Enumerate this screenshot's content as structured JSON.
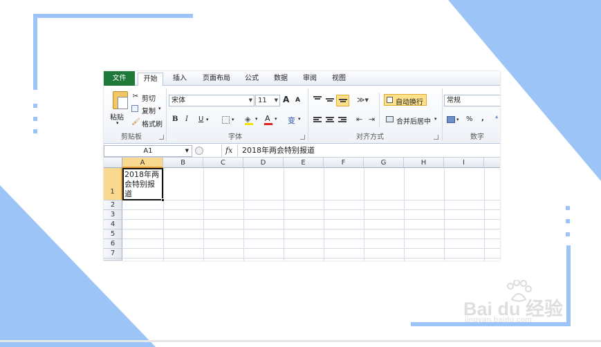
{
  "tabs": [
    {
      "label": "文件"
    },
    {
      "label": "开始"
    },
    {
      "label": "插入"
    },
    {
      "label": "页面布局"
    },
    {
      "label": "公式"
    },
    {
      "label": "数据"
    },
    {
      "label": "审阅"
    },
    {
      "label": "视图"
    }
  ],
  "clipboard": {
    "paste": "粘贴",
    "cut": "剪切",
    "copy": "复制",
    "format_painter": "格式刷",
    "label": "剪贴板"
  },
  "font": {
    "name": "宋体",
    "size": "11",
    "grow": "A",
    "shrink": "A",
    "bold": "B",
    "italic": "I",
    "underline": "U",
    "color_letter": "A",
    "phonetic": "变",
    "label": "字体"
  },
  "alignment": {
    "wrap_text": "自动换行",
    "merge_center": "合并后居中",
    "label": "对齐方式"
  },
  "number": {
    "format": "常规",
    "percent": "%",
    "comma": ",",
    "label": "数字"
  },
  "formula_bar": {
    "name_box": "A1",
    "fx": "fx",
    "content": "2018年两会特别报道"
  },
  "grid": {
    "columns": [
      "A",
      "B",
      "C",
      "D",
      "E",
      "F",
      "G",
      "H",
      "I"
    ],
    "rows": [
      "1",
      "2",
      "3",
      "4",
      "5",
      "6",
      "7"
    ],
    "a1_lines": [
      "2018年两",
      "会特别报",
      "道"
    ]
  },
  "colors": {
    "file_tab": "#1f7a3a",
    "highlight": "#fde08a",
    "deco": "#9cc4f6",
    "font_color_bar": "#e02020",
    "fill_color_bar": "#f5e100"
  },
  "watermark": {
    "brand": "Bai du 经验",
    "url": "jingyan.baidu.com"
  }
}
